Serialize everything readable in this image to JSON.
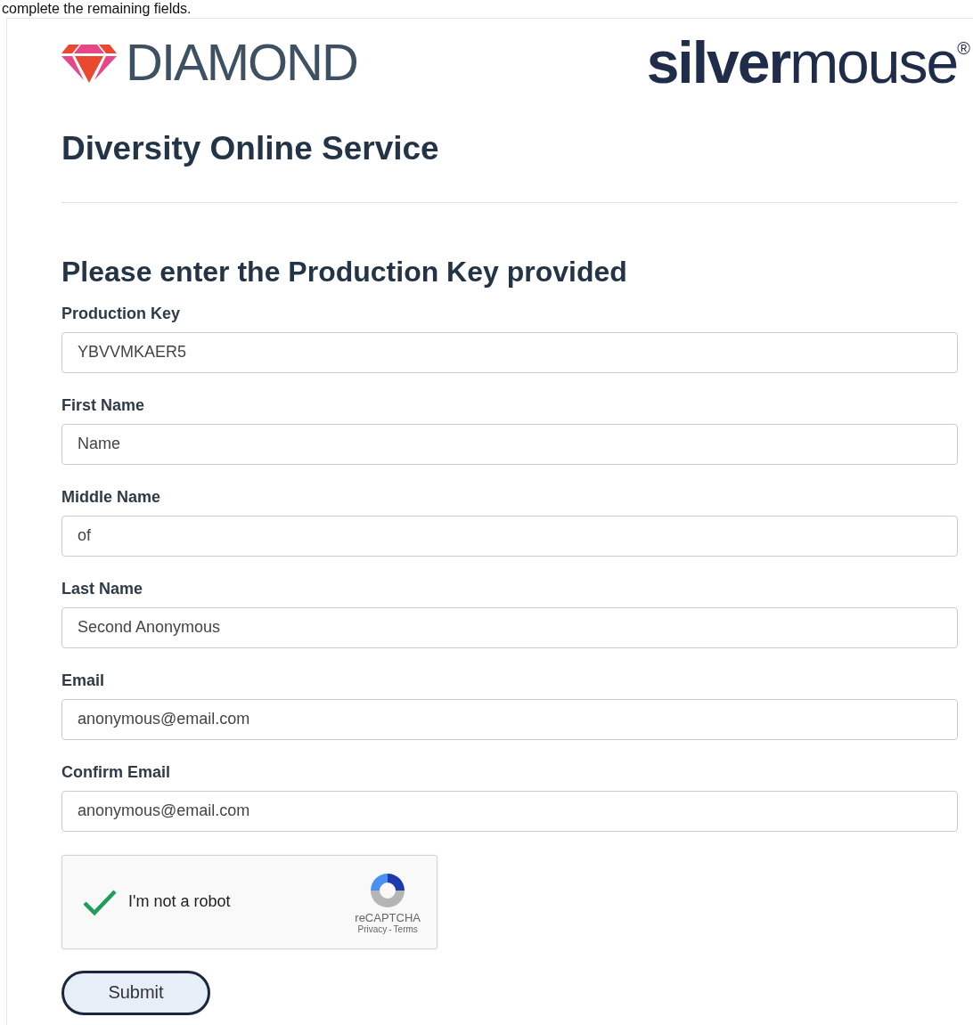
{
  "intro": "complete the remaining fields.",
  "logos": {
    "left": "DIAMOND",
    "right": "**silver**mouse$^{®}$"
  },
  "title": "Diversity Online Service",
  "heading": "Please enter the Production Key provided",
  "fields": [
    {
      "label": "Production Key",
      "value": "YBVVMKAER5"
    },
    {
      "label": "First Name",
      "value": "Name"
    },
    {
      "label": "Middle Name",
      "value": "of"
    },
    {
      "label": "Last Name",
      "value": "Second Anonymous"
    },
    {
      "label": "Email",
      "value": "anonymous@email.com"
    },
    {
      "label": "Confirm Email",
      "value": "anonymous@email.com"
    }
  ],
  "captcha": {
    "label": "I'm not a robot",
    "checked": true,
    "brand": "reCAPTCHA",
    "privacy": "Privacy",
    "separator": "-",
    "terms": "Terms"
  },
  "submit": "Submit"
}
